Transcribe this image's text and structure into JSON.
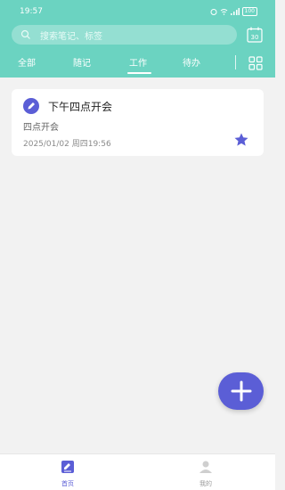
{
  "status_bar": {
    "time": "19:57",
    "battery": "100"
  },
  "search": {
    "placeholder": "搜索笔记、标签"
  },
  "calendar": {
    "day": "30"
  },
  "tabs": [
    {
      "label": "全部"
    },
    {
      "label": "随记"
    },
    {
      "label": "工作",
      "selected": true
    },
    {
      "label": "待办"
    }
  ],
  "note": {
    "title": "下午四点开会",
    "body": "四点开会",
    "date": "2025/01/02 周四19:56"
  },
  "bottom_nav": [
    {
      "label": "首页",
      "active": true
    },
    {
      "label": "我的"
    }
  ],
  "colors": {
    "header": "#6bd3c1",
    "accent": "#5b5ed6"
  }
}
